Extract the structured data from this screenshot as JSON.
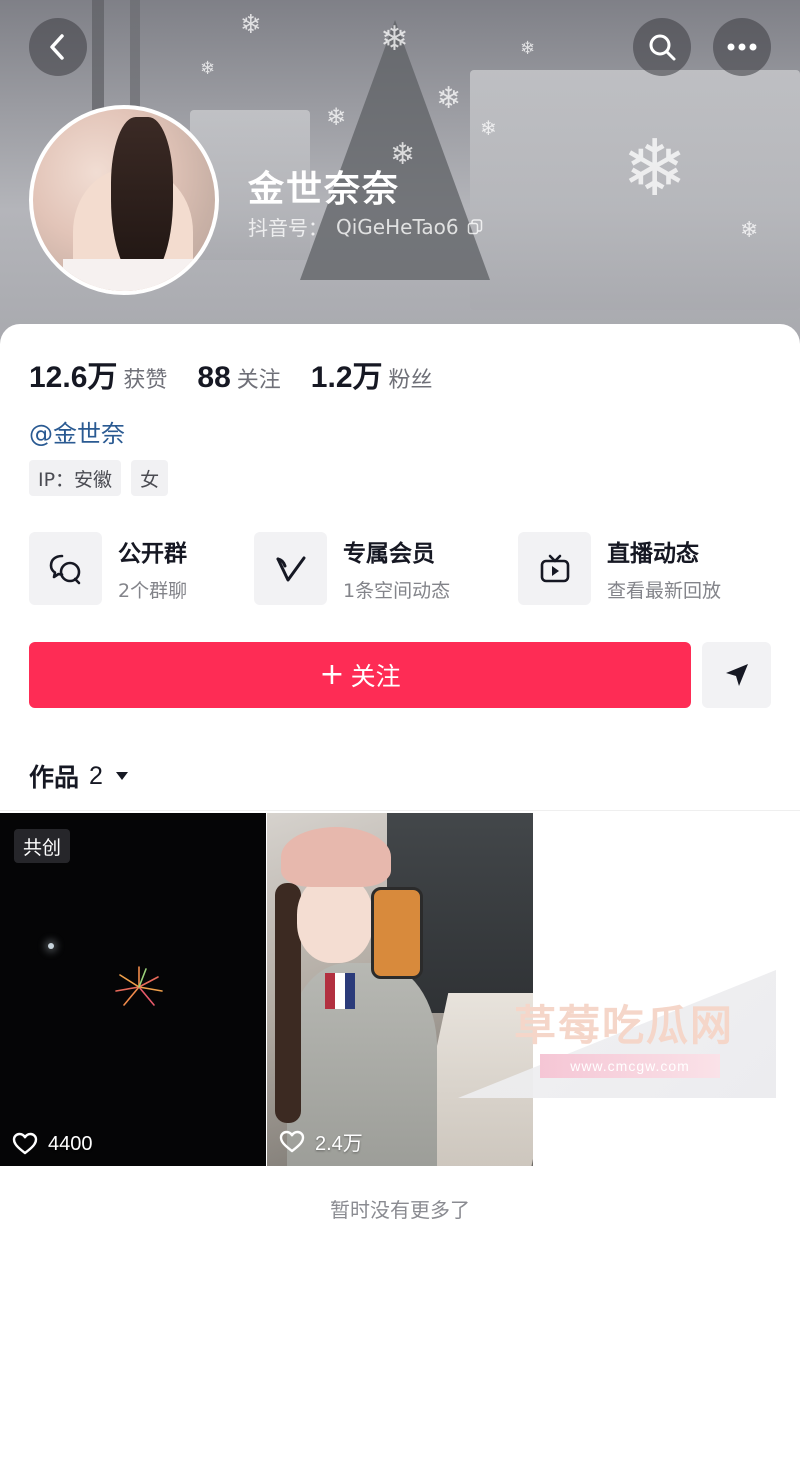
{
  "header": {
    "back_icon": "chevron-left-icon",
    "search_icon": "search-icon",
    "more_icon": "more-horizontal-icon"
  },
  "profile": {
    "name": "金世奈奈",
    "douyin_id_label": "抖音号：",
    "douyin_id": "QiGeHeTao6",
    "mention": "@金世奈",
    "tags": [
      "IP：安徽",
      "女"
    ]
  },
  "stats": [
    {
      "value": "12.6万",
      "label": "获赞"
    },
    {
      "value": "88",
      "label": "关注"
    },
    {
      "value": "1.2万",
      "label": "粉丝"
    }
  ],
  "features": [
    {
      "title": "公开群",
      "subtitle": "2个群聊",
      "icon": "group-chat-icon"
    },
    {
      "title": "专属会员",
      "subtitle": "1条空间动态",
      "icon": "vip-v-icon"
    },
    {
      "title": "直播动态",
      "subtitle": "查看最新回放",
      "icon": "live-tv-icon"
    }
  ],
  "actions": {
    "follow_plus": "+",
    "follow_label": "关注",
    "share_icon": "send-arrow-icon"
  },
  "works": {
    "label": "作品",
    "count": "2",
    "videos": [
      {
        "badge": "共创",
        "likes": "4400"
      },
      {
        "badge": "",
        "likes": "2.4万"
      }
    ],
    "end_text": "暂时没有更多了"
  },
  "watermark": {
    "title": "草莓吃瓜网",
    "url": "www.cmcgw.com"
  },
  "colors": {
    "accent": "#fe2c55",
    "mention": "#2a5a92",
    "text_primary": "#161823",
    "text_secondary": "#83848a"
  }
}
